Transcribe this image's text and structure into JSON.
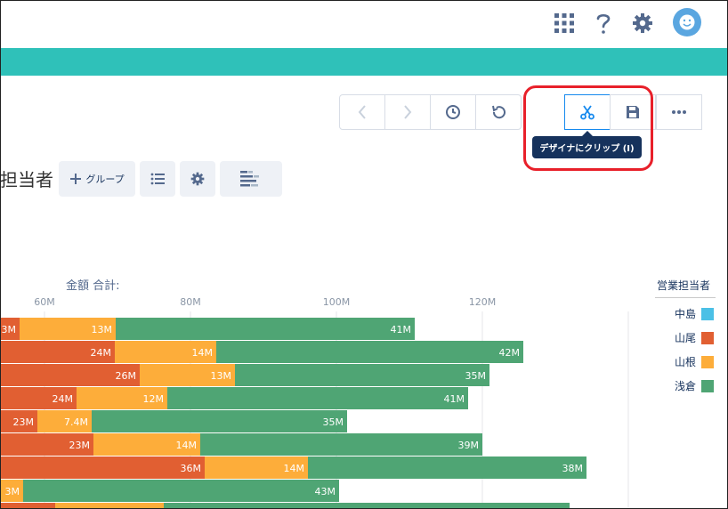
{
  "header": {
    "apps_icon": "grid-icon",
    "help_icon": "help-icon",
    "settings_icon": "gear-icon",
    "avatar_icon": "avatar-icon"
  },
  "toolbar": {
    "nav_icons": [
      "back-icon",
      "forward-icon",
      "history-icon",
      "undo-icon"
    ],
    "clip_icon": "scissors-icon",
    "save_icon": "save-icon",
    "more_icon": "more-icon",
    "tooltip": "デザイナにクリップ (I)"
  },
  "page": {
    "title": "担当者",
    "group_button": "グループ"
  },
  "colors": {
    "teal": "#2fc1b9",
    "nakajima": "#4bc0e6",
    "yamao": "#e15f32",
    "yamane": "#fdad3a",
    "asakura": "#4fa574"
  },
  "chart_data": {
    "type": "bar",
    "orientation": "horizontal",
    "stacked": true,
    "xlabel": "金額 合計:",
    "x_ticks": [
      "60M",
      "80M",
      "100M",
      "120M"
    ],
    "legend_title": "営業担当者",
    "legend_placement": "right",
    "series": [
      {
        "name": "中島",
        "values": [
          null,
          null,
          null,
          null,
          null,
          null,
          null,
          null
        ]
      },
      {
        "name": "山尾",
        "values": [
          null,
          24,
          26,
          24,
          23,
          23,
          36,
          null
        ]
      },
      {
        "name": "山根",
        "values": [
          13,
          14,
          13,
          12,
          7.4,
          14,
          14,
          null
        ]
      },
      {
        "name": "浅倉",
        "values": [
          41,
          42,
          35,
          41,
          35,
          39,
          38,
          43
        ]
      }
    ],
    "partial_labels": [
      "3M",
      "",
      "",
      "",
      "",
      "",
      "",
      "3M"
    ]
  }
}
